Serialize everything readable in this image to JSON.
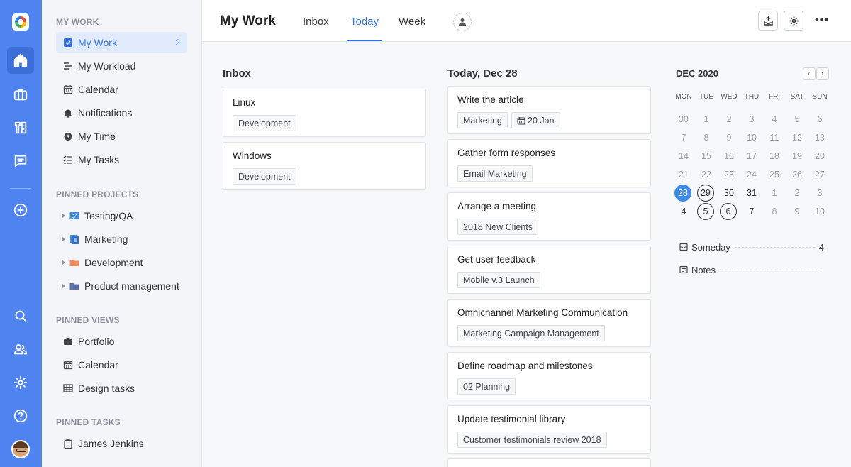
{
  "header": {
    "title": "My Work",
    "tabs": [
      {
        "label": "Inbox"
      },
      {
        "label": "Today"
      },
      {
        "label": "Week"
      }
    ]
  },
  "sidebar": {
    "my_work_title": "MY WORK",
    "my_work_items": [
      {
        "label": "My Work",
        "count": "2",
        "icon": "checkbox-icon"
      },
      {
        "label": "My Workload",
        "icon": "workload-icon"
      },
      {
        "label": "Calendar",
        "icon": "calendar-icon"
      },
      {
        "label": "Notifications",
        "icon": "bell-icon"
      },
      {
        "label": "My Time",
        "icon": "clock-icon"
      },
      {
        "label": "My Tasks",
        "icon": "task-list-icon"
      }
    ],
    "pinned_projects_title": "PINNED PROJECTS",
    "pinned_projects": [
      {
        "label": "Testing/QA",
        "icon": "qa-icon"
      },
      {
        "label": "Marketing",
        "icon": "document-icon"
      },
      {
        "label": "Development",
        "icon": "folder-icon"
      },
      {
        "label": "Product management",
        "icon": "folder-icon"
      }
    ],
    "pinned_views_title": "PINNED VIEWS",
    "pinned_views": [
      {
        "label": "Portfolio",
        "icon": "briefcase-icon"
      },
      {
        "label": "Calendar",
        "icon": "calendar-icon"
      },
      {
        "label": "Design tasks",
        "icon": "table-icon"
      }
    ],
    "pinned_tasks_title": "PINNED TASKS",
    "pinned_tasks": [
      {
        "label": "James Jenkins",
        "icon": "clipboard-icon"
      }
    ]
  },
  "inbox": {
    "title": "Inbox",
    "cards": [
      {
        "title": "Linux",
        "tag": "Development"
      },
      {
        "title": "Windows",
        "tag": "Development"
      }
    ]
  },
  "today": {
    "title": "Today, Dec 28",
    "cards": [
      {
        "title": "Write the article",
        "tag": "Marketing",
        "date": "20 Jan"
      },
      {
        "title": "Gather form responses",
        "tag": "Email Marketing"
      },
      {
        "title": "Arrange a meeting",
        "tag": "2018 New Clients"
      },
      {
        "title": "Get user feedback",
        "tag": "Mobile v.3 Launch"
      },
      {
        "title": "Omnichannel Marketing Communication",
        "tag": "Marketing Campaign Management"
      },
      {
        "title": "Define roadmap and milestones",
        "tag": "02 Planning"
      },
      {
        "title": "Update testimonial library",
        "tag": "Customer testimonials review 2018"
      }
    ]
  },
  "calendar": {
    "title": "DEC 2020",
    "prev": "‹",
    "next": "›",
    "weekdays": [
      "MON",
      "TUE",
      "WED",
      "THU",
      "FRI",
      "SAT",
      "SUN"
    ],
    "weeks": [
      [
        "30",
        "1",
        "2",
        "3",
        "4",
        "5",
        "6"
      ],
      [
        "7",
        "8",
        "9",
        "10",
        "11",
        "12",
        "13"
      ],
      [
        "14",
        "15",
        "16",
        "17",
        "18",
        "19",
        "20"
      ],
      [
        "21",
        "22",
        "23",
        "24",
        "25",
        "26",
        "27"
      ],
      [
        "28",
        "29",
        "30",
        "31",
        "1",
        "2",
        "3"
      ],
      [
        "4",
        "5",
        "6",
        "7",
        "8",
        "9",
        "10"
      ]
    ],
    "today": "28",
    "someday_label": "Someday",
    "someday_count": "4",
    "notes_label": "Notes"
  },
  "colors": {
    "rail": "#4f83f0",
    "accent": "#3372e3",
    "today_circle": "#3d8be6"
  }
}
